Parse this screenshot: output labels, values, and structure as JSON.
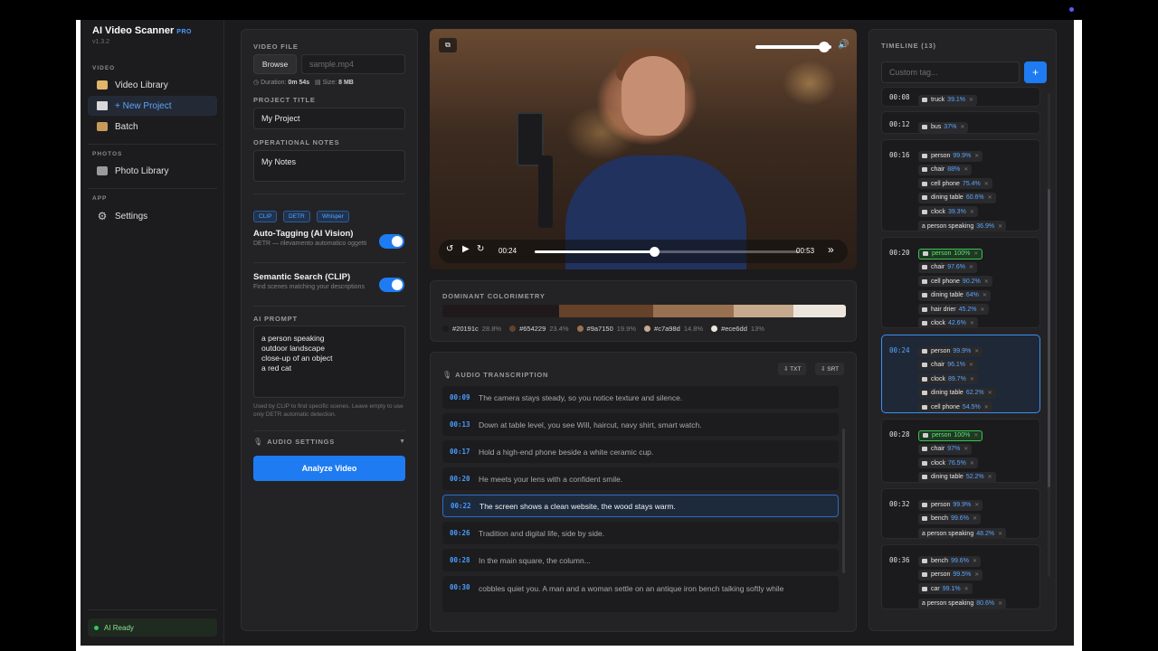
{
  "sidebar": {
    "brand": "AI Video Scanner",
    "brand_badge": "PRO",
    "version": "v1.3.2",
    "sections": [
      {
        "label": "VIDEO"
      },
      {
        "label": "PHOTOS"
      },
      {
        "label": "APP"
      }
    ],
    "items": [
      {
        "label": "Video Library",
        "icon": "folder-icon"
      },
      {
        "label": "+ New Project",
        "icon": "clapper-icon",
        "active": true
      },
      {
        "label": "Batch",
        "icon": "box-icon"
      },
      {
        "label": "Photo Library",
        "icon": "camera-icon"
      },
      {
        "label": "Settings",
        "icon": "gear-icon"
      }
    ],
    "status": "AI Ready"
  },
  "config": {
    "video_file_label": "VIDEO FILE",
    "browse_label": "Browse",
    "file_placeholder": "sample.mp4",
    "duration_label": "Duration:",
    "duration_value": "0m 54s",
    "size_label": "Size:",
    "size_value": "8 MB",
    "project_title_label": "PROJECT TITLE",
    "project_title_value": "My Project",
    "notes_label": "OPERATIONAL NOTES",
    "notes_value": "My Notes",
    "chips": [
      "CLIP",
      "DETR",
      "Whisper"
    ],
    "auto_tagging_title": "Auto-Tagging (AI Vision)",
    "auto_tagging_desc": "DETR — rilevamento automatico oggetti",
    "auto_tagging_on": true,
    "semantic_title": "Semantic Search (CLIP)",
    "semantic_desc": "Find scenes matching your descriptions",
    "semantic_on": true,
    "ai_prompt_label": "AI PROMPT",
    "ai_prompt_lines": [
      "a person speaking",
      "outdoor landscape",
      "close-up of an object",
      "a red cat"
    ],
    "hint": "Used by CLIP to find specific scenes. Leave empty to use only DETR automatic detection.",
    "audio_settings_label": "AUDIO SETTINGS",
    "analyze_label": "Analyze Video"
  },
  "player": {
    "current_time": "00:24",
    "duration": "00:53",
    "progress": 0.4528,
    "volume": 0.9
  },
  "colorimetry": {
    "label": "DOMINANT COLORIMETRY",
    "colors": [
      {
        "hex": "#20191c",
        "pct": "28.8%",
        "value": 28.8
      },
      {
        "hex": "#654229",
        "pct": "23.4%",
        "value": 23.4
      },
      {
        "hex": "#9a7150",
        "pct": "19.9%",
        "value": 19.9
      },
      {
        "hex": "#c7a98d",
        "pct": "14.8%",
        "value": 14.8
      },
      {
        "hex": "#ece6dd",
        "pct": "13%",
        "value": 13.0
      }
    ]
  },
  "transcription": {
    "label": "AUDIO TRANSCRIPTION",
    "txt_label": "⇩ TXT",
    "srt_label": "⇩ SRT",
    "rows": [
      {
        "time": "00:09",
        "text": "The camera stays steady, so you notice texture and silence."
      },
      {
        "time": "00:13",
        "text": "Down at table level, you see Will, haircut, navy shirt, smart watch."
      },
      {
        "time": "00:17",
        "text": "Hold a high-end phone beside a white ceramic cup."
      },
      {
        "time": "00:20",
        "text": "He meets your lens with a confident smile."
      },
      {
        "time": "00:22",
        "text": "The screen shows a clean website, the wood stays warm.",
        "active": true
      },
      {
        "time": "00:26",
        "text": "Tradition and digital life, side by side."
      },
      {
        "time": "00:28",
        "text": "In the main square, the column..."
      },
      {
        "time": "00:30",
        "text": "cobbles quiet you. A man and a woman settle on an antique iron bench talking softly while"
      }
    ]
  },
  "timeline": {
    "label": "TIMELINE (13)",
    "custom_tag_placeholder": "Custom tag...",
    "add_label": "+",
    "cards": [
      {
        "time": "00:08",
        "tags": [
          {
            "name": "truck",
            "conf": "39.1%"
          }
        ]
      },
      {
        "time": "00:12",
        "tags": [
          {
            "name": "bus",
            "conf": "37%"
          }
        ]
      },
      {
        "time": "00:16",
        "tags": [
          {
            "name": "person",
            "conf": "99.9%"
          },
          {
            "name": "chair",
            "conf": "88%"
          },
          {
            "name": "cell phone",
            "conf": "75.4%"
          },
          {
            "name": "dining table",
            "conf": "60.6%"
          },
          {
            "name": "clock",
            "conf": "39.3%"
          },
          {
            "name": "a person speaking",
            "conf": "36.9%",
            "prompt": true
          }
        ]
      },
      {
        "time": "00:20",
        "tags": [
          {
            "name": "person",
            "conf": "100%",
            "green": true
          },
          {
            "name": "chair",
            "conf": "97.6%"
          },
          {
            "name": "cell phone",
            "conf": "90.2%"
          },
          {
            "name": "dining table",
            "conf": "64%"
          },
          {
            "name": "hair drier",
            "conf": "45.2%"
          },
          {
            "name": "clock",
            "conf": "42.6%"
          }
        ]
      },
      {
        "time": "00:24",
        "active": true,
        "tags": [
          {
            "name": "person",
            "conf": "99.9%"
          },
          {
            "name": "chair",
            "conf": "96.1%"
          },
          {
            "name": "clock",
            "conf": "89.7%"
          },
          {
            "name": "dining table",
            "conf": "62.2%"
          },
          {
            "name": "cell phone",
            "conf": "54.5%"
          }
        ]
      },
      {
        "time": "00:28",
        "tags": [
          {
            "name": "person",
            "conf": "100%",
            "green": true
          },
          {
            "name": "chair",
            "conf": "97%"
          },
          {
            "name": "clock",
            "conf": "76.5%"
          },
          {
            "name": "dining table",
            "conf": "52.2%"
          }
        ]
      },
      {
        "time": "00:32",
        "tags": [
          {
            "name": "person",
            "conf": "99.9%"
          },
          {
            "name": "bench",
            "conf": "99.6%"
          },
          {
            "name": "a person speaking",
            "conf": "48.2%",
            "prompt": true
          }
        ]
      },
      {
        "time": "00:36",
        "tags": [
          {
            "name": "bench",
            "conf": "99.6%"
          },
          {
            "name": "person",
            "conf": "99.5%"
          },
          {
            "name": "car",
            "conf": "99.1%"
          },
          {
            "name": "a person speaking",
            "conf": "80.6%",
            "prompt": true
          }
        ]
      }
    ]
  }
}
